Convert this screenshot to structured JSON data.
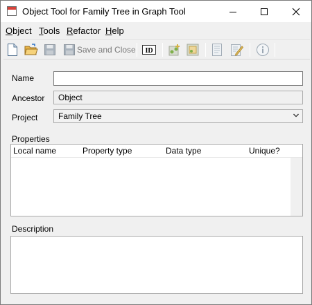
{
  "window": {
    "title": "Object Tool for Family Tree in Graph Tool"
  },
  "menu": [
    {
      "label": "Object",
      "mnemonic": "O",
      "rest": "bject"
    },
    {
      "label": "Tools",
      "mnemonic": "T",
      "rest": "ools"
    },
    {
      "label": "Refactor",
      "mnemonic": "R",
      "rest": "efactor"
    },
    {
      "label": "Help",
      "mnemonic": "H",
      "rest": "elp"
    }
  ],
  "toolbar": {
    "save_and_close_label": "Save and Close",
    "id_label": "ID",
    "icons": [
      "new-document-icon",
      "open-folder-icon",
      "save-icon",
      "save-and-close-icon",
      "id-icon",
      "graph-add-icon",
      "graph-edit-icon",
      "document-icon",
      "edit-document-icon",
      "info-icon"
    ]
  },
  "form": {
    "name_label": "Name",
    "name_value": "",
    "ancestor_label": "Ancestor",
    "ancestor_value": "Object",
    "project_label": "Project",
    "project_value": "Family Tree",
    "properties_label": "Properties",
    "description_label": "Description",
    "description_value": ""
  },
  "properties_table": {
    "columns": [
      "Local name",
      "Property type",
      "Data type",
      "Unique?"
    ],
    "rows": []
  },
  "colors": {
    "window_bg": "#f0f0f0",
    "title_bg": "#ffffff",
    "icon_red": "#d8433a",
    "disabled_text": "#7a7a7a"
  }
}
